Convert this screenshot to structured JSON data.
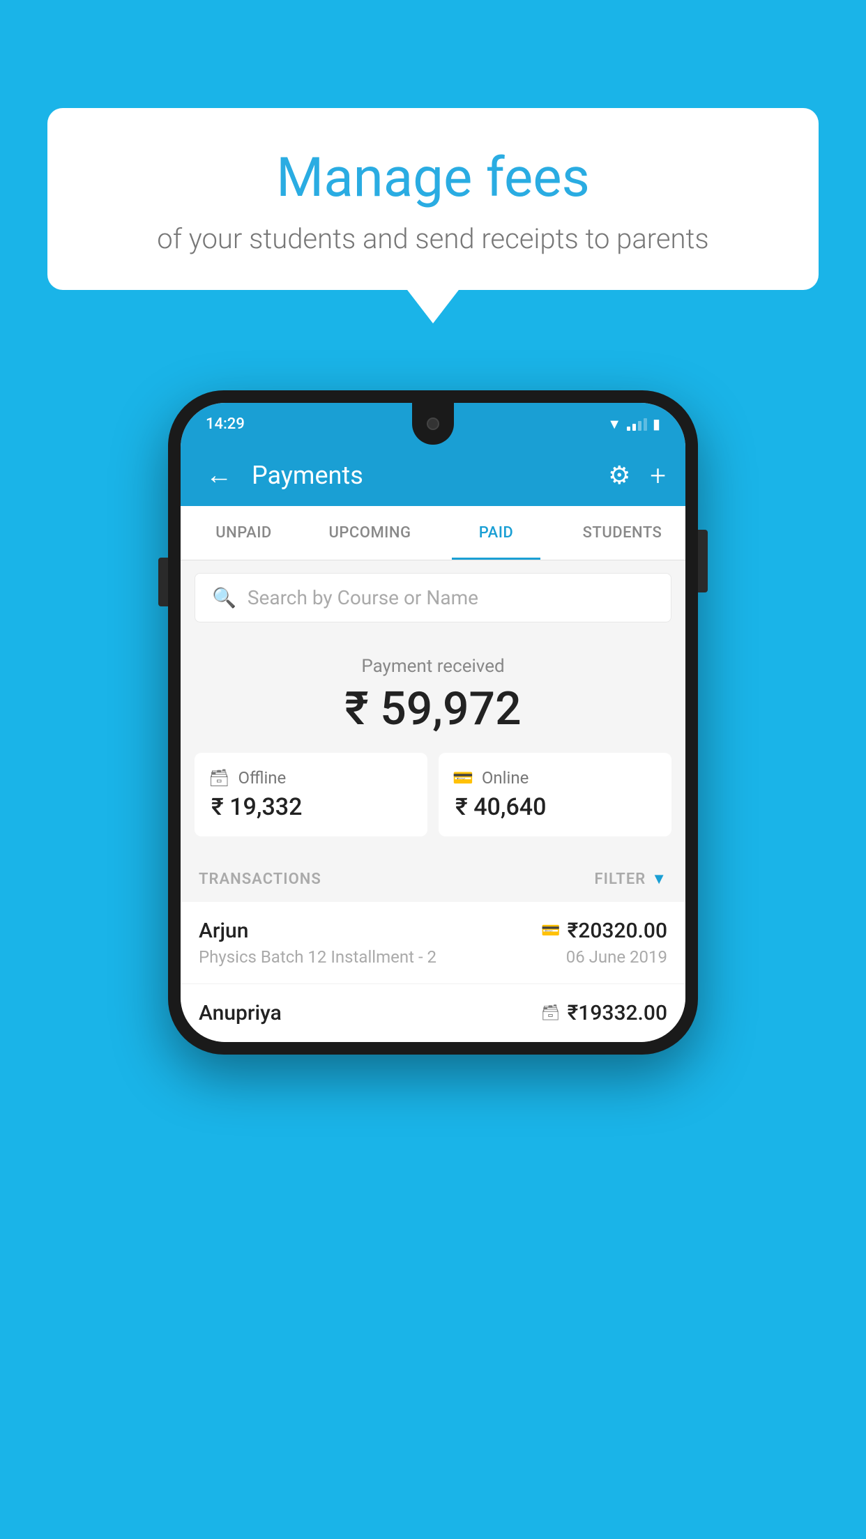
{
  "background_color": "#1ab4e8",
  "speech_bubble": {
    "title": "Manage fees",
    "subtitle": "of your students and send receipts to parents"
  },
  "status_bar": {
    "time": "14:29"
  },
  "header": {
    "title": "Payments",
    "back_label": "←",
    "gear_label": "⚙",
    "plus_label": "+"
  },
  "tabs": [
    {
      "id": "unpaid",
      "label": "UNPAID",
      "active": false
    },
    {
      "id": "upcoming",
      "label": "UPCOMING",
      "active": false
    },
    {
      "id": "paid",
      "label": "PAID",
      "active": true
    },
    {
      "id": "students",
      "label": "STUDENTS",
      "active": false
    }
  ],
  "search": {
    "placeholder": "Search by Course or Name"
  },
  "payment_received": {
    "label": "Payment received",
    "amount": "₹ 59,972",
    "offline": {
      "label": "Offline",
      "amount": "₹ 19,332"
    },
    "online": {
      "label": "Online",
      "amount": "₹ 40,640"
    }
  },
  "transactions_section": {
    "label": "TRANSACTIONS",
    "filter_label": "FILTER",
    "rows": [
      {
        "name": "Arjun",
        "amount": "₹20320.00",
        "description": "Physics Batch 12 Installment - 2",
        "date": "06 June 2019",
        "type": "online"
      },
      {
        "name": "Anupriya",
        "amount": "₹19332.00",
        "description": "",
        "date": "",
        "type": "offline"
      }
    ]
  }
}
